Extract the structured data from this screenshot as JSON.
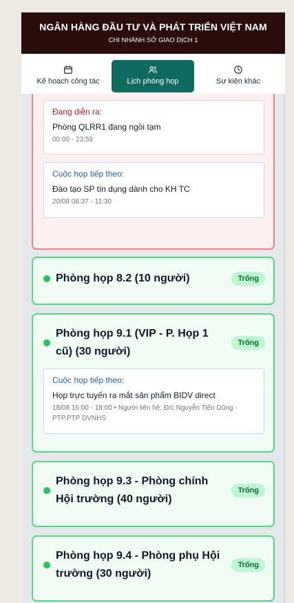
{
  "header": {
    "title": "NGÂN HÀNG ĐẦU TƯ VÀ PHÁT TRIỂN VIỆT NAM",
    "subtitle": "CHI NHÁNH SỞ GIAO DỊCH 1"
  },
  "tabs": [
    {
      "label": "Kế hoạch công tác",
      "icon": "calendar-icon",
      "active": false
    },
    {
      "label": "Lịch phòng họp",
      "icon": "users-icon",
      "active": true
    },
    {
      "label": "Sự kiện khác",
      "icon": "clock-icon",
      "active": false
    }
  ],
  "rooms": [
    {
      "status": "busy",
      "now": {
        "label": "Đang diễn ra:",
        "event": "Phòng QLRR1 đang ngồi tạm",
        "time": "00:00 - 23:59"
      },
      "next": {
        "label": "Cuộc họp tiếp theo:",
        "event": "Đào tạo SP tín dụng dành cho KH TC",
        "time": "20/08 08:37 - 11:30"
      }
    },
    {
      "name": "Phòng họp 8.2 (10 người)",
      "badge": "Trống",
      "status": "free"
    },
    {
      "name": "Phòng họp 9.1 (VIP - P. Họp 1 cũ) (30 người)",
      "badge": "Trống",
      "status": "free",
      "next": {
        "label": "Cuộc họp tiếp theo:",
        "event": "Họp trực tuyến ra mắt sản phẩm BIDV direct",
        "time": "18/08 16:00 - 18:00 • Người liên hệ: Đ/c Nguyễn Tiến Dũng - PTP.PTP DVNHS"
      }
    },
    {
      "name": "Phòng họp 9.3 - Phòng chính Hội trường (40 người)",
      "badge": "Trống",
      "status": "free"
    },
    {
      "name": "Phòng họp 9.4 - Phòng phụ Hội trường (30 người)",
      "badge": "Trống",
      "status": "free"
    }
  ],
  "colors": {
    "header_bg": "#2a0e0c",
    "tab_active": "#0f6b60",
    "free_border": "#4ade80",
    "busy_border": "#f08080",
    "badge_bg": "#bbf7d0"
  }
}
